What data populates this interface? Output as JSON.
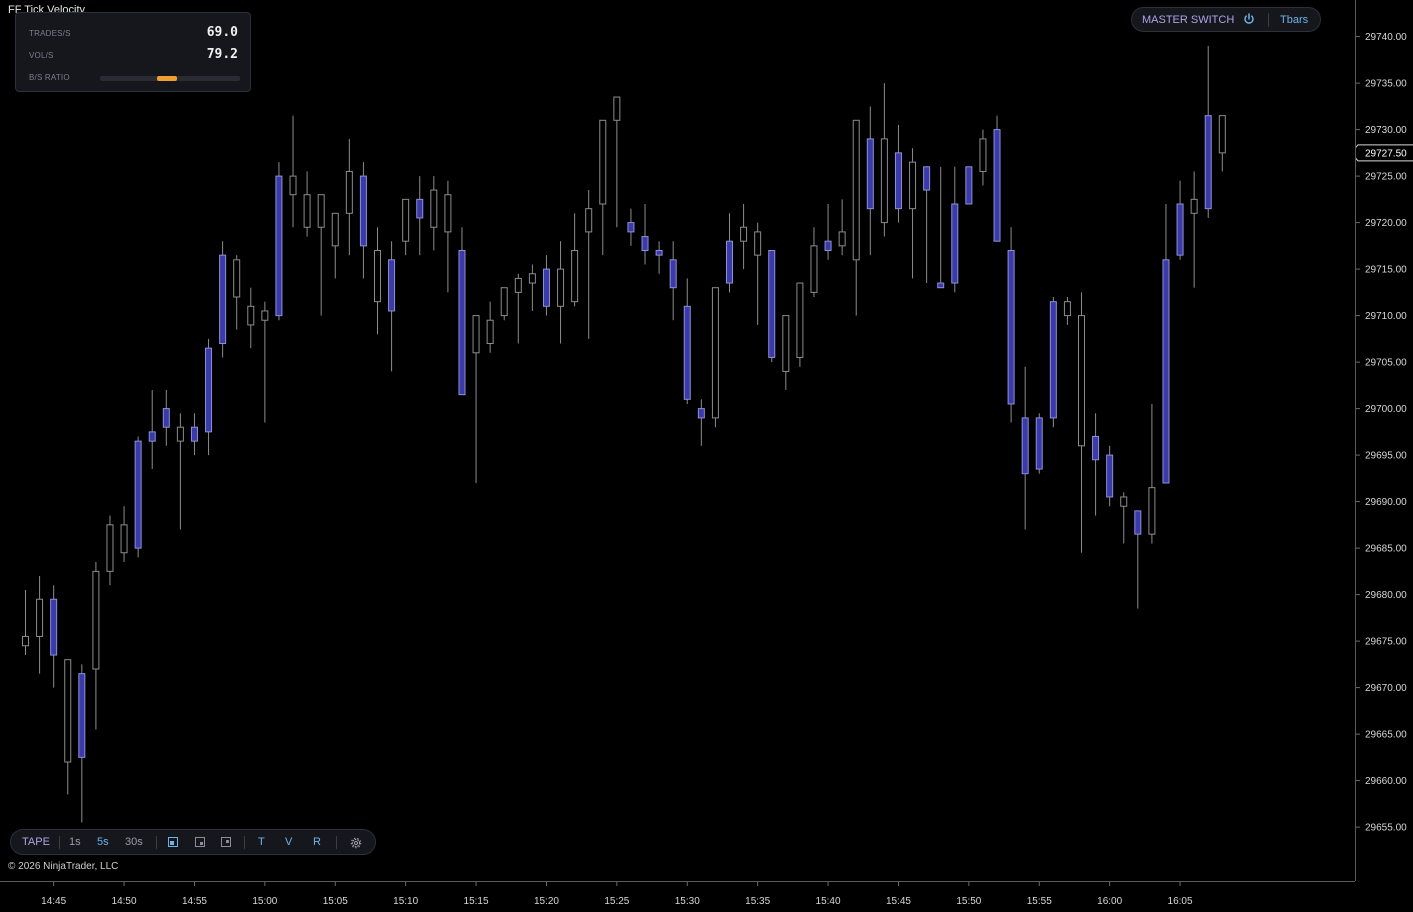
{
  "indicator": {
    "title": "FF Tick Velocity",
    "trades_label": "TRADES/S",
    "trades_value": "69.0",
    "vol_label": "VOL/S",
    "vol_value": "79.2",
    "ratio_label": "B/S RATIO",
    "ratio_value": 0.48,
    "ratio_color": "#f0a030"
  },
  "master_switch": {
    "label": "MASTER SWITCH",
    "power_icon": "power-icon",
    "tbars_label": "Tbars"
  },
  "toolbar": {
    "tape_label": "TAPE",
    "intervals": [
      "1s",
      "5s",
      "30s"
    ],
    "layout_icons": [
      "layout-single-icon",
      "layout-split-icon",
      "layout-grid-icon"
    ],
    "toggles": [
      "T",
      "V",
      "R"
    ],
    "settings_icon": "gear-icon"
  },
  "copyright": "© 2026 NinjaTrader, LLC",
  "colors": {
    "background": "#000000",
    "up_fill": "#000000",
    "up_border": "#8c8c8c",
    "down_fill": "#3a3aa8",
    "down_border": "#8f8fd8",
    "wick": "#8c8c8c",
    "axis_text": "#d8d8d8"
  },
  "chart_data": {
    "type": "candlestick",
    "y_axis_ticks": [
      "29740.00",
      "29735.00",
      "29730.00",
      "29725.00",
      "29720.00",
      "29715.00",
      "29710.00",
      "29705.00",
      "29700.00",
      "29695.00",
      "29690.00",
      "29685.00",
      "29680.00",
      "29675.00",
      "29670.00",
      "29665.00",
      "29660.00",
      "29655.00"
    ],
    "ylim": [
      29652,
      29742
    ],
    "x_axis_labels": [
      "14:45",
      "14:50",
      "14:55",
      "15:00",
      "15:05",
      "15:10",
      "15:15",
      "15:20",
      "15:25",
      "15:30",
      "15:35",
      "15:40",
      "15:45",
      "15:50",
      "15:55",
      "16:00",
      "16:05"
    ],
    "current_price": "29727.50",
    "candles": [
      {
        "o": 29674.5,
        "h": 29680.5,
        "l": 29673.5,
        "c": 29675.5
      },
      {
        "o": 29675.5,
        "h": 29682.0,
        "l": 29671.5,
        "c": 29679.5
      },
      {
        "o": 29679.5,
        "h": 29681.0,
        "l": 29670.0,
        "c": 29673.5
      },
      {
        "o": 29662.0,
        "h": 29673.0,
        "l": 29658.5,
        "c": 29673.0
      },
      {
        "o": 29671.5,
        "h": 29672.5,
        "l": 29655.5,
        "c": 29662.5
      },
      {
        "o": 29672.0,
        "h": 29683.5,
        "l": 29665.5,
        "c": 29682.5
      },
      {
        "o": 29682.5,
        "h": 29688.5,
        "l": 29681.0,
        "c": 29687.5
      },
      {
        "o": 29684.5,
        "h": 29689.5,
        "l": 29683.5,
        "c": 29687.5
      },
      {
        "o": 29696.5,
        "h": 29697.0,
        "l": 29684.0,
        "c": 29685.0
      },
      {
        "o": 29697.5,
        "h": 29702.0,
        "l": 29693.5,
        "c": 29696.5
      },
      {
        "o": 29700.0,
        "h": 29702.0,
        "l": 29696.0,
        "c": 29698.0
      },
      {
        "o": 29696.5,
        "h": 29699.5,
        "l": 29687.0,
        "c": 29698.0
      },
      {
        "o": 29698.0,
        "h": 29699.5,
        "l": 29695.0,
        "c": 29696.5
      },
      {
        "o": 29706.5,
        "h": 29707.5,
        "l": 29695.0,
        "c": 29697.5
      },
      {
        "o": 29716.5,
        "h": 29718.0,
        "l": 29705.5,
        "c": 29707.0
      },
      {
        "o": 29712.0,
        "h": 29716.5,
        "l": 29708.5,
        "c": 29716.0
      },
      {
        "o": 29709.0,
        "h": 29713.0,
        "l": 29706.5,
        "c": 29711.0
      },
      {
        "o": 29709.5,
        "h": 29711.5,
        "l": 29698.5,
        "c": 29710.5
      },
      {
        "o": 29725.0,
        "h": 29726.5,
        "l": 29709.5,
        "c": 29710.0
      },
      {
        "o": 29723.0,
        "h": 29731.5,
        "l": 29719.5,
        "c": 29725.0
      },
      {
        "o": 29719.5,
        "h": 29725.5,
        "l": 29718.5,
        "c": 29723.0
      },
      {
        "o": 29719.5,
        "h": 29722.0,
        "l": 29710.0,
        "c": 29723.0
      },
      {
        "o": 29717.5,
        "h": 29721.0,
        "l": 29714.0,
        "c": 29721.0
      },
      {
        "o": 29721.0,
        "h": 29729.0,
        "l": 29716.5,
        "c": 29725.5
      },
      {
        "o": 29725.0,
        "h": 29726.5,
        "l": 29714.0,
        "c": 29717.5
      },
      {
        "o": 29711.5,
        "h": 29719.5,
        "l": 29708.0,
        "c": 29717.0
      },
      {
        "o": 29716.0,
        "h": 29718.0,
        "l": 29704.0,
        "c": 29710.5
      },
      {
        "o": 29718.0,
        "h": 29720.0,
        "l": 29716.5,
        "c": 29722.5
      },
      {
        "o": 29722.5,
        "h": 29725.0,
        "l": 29716.5,
        "c": 29720.5
      },
      {
        "o": 29719.5,
        "h": 29725.0,
        "l": 29717.0,
        "c": 29723.5
      },
      {
        "o": 29719.0,
        "h": 29724.5,
        "l": 29712.5,
        "c": 29723.0
      },
      {
        "o": 29717.0,
        "h": 29719.5,
        "l": 29702.0,
        "c": 29701.5
      },
      {
        "o": 29706.0,
        "h": 29707.0,
        "l": 29692.0,
        "c": 29710.0
      },
      {
        "o": 29707.0,
        "h": 29711.5,
        "l": 29706.0,
        "c": 29709.5
      },
      {
        "o": 29710.0,
        "h": 29713.0,
        "l": 29709.5,
        "c": 29713.0
      },
      {
        "o": 29712.5,
        "h": 29714.5,
        "l": 29707.0,
        "c": 29714.0
      },
      {
        "o": 29713.5,
        "h": 29715.5,
        "l": 29710.5,
        "c": 29714.5
      },
      {
        "o": 29715.0,
        "h": 29716.5,
        "l": 29710.0,
        "c": 29711.0
      },
      {
        "o": 29711.0,
        "h": 29718.0,
        "l": 29707.0,
        "c": 29715.0
      },
      {
        "o": 29711.5,
        "h": 29721.0,
        "l": 29711.0,
        "c": 29717.0
      },
      {
        "o": 29719.0,
        "h": 29723.5,
        "l": 29707.5,
        "c": 29721.5
      },
      {
        "o": 29722.0,
        "h": 29727.0,
        "l": 29716.5,
        "c": 29731.0
      },
      {
        "o": 29731.0,
        "h": 29731.5,
        "l": 29719.5,
        "c": 29733.5
      },
      {
        "o": 29720.0,
        "h": 29721.5,
        "l": 29717.5,
        "c": 29719.0
      },
      {
        "o": 29718.5,
        "h": 29722.0,
        "l": 29715.5,
        "c": 29717.0
      },
      {
        "o": 29717.0,
        "h": 29718.0,
        "l": 29714.5,
        "c": 29716.5
      },
      {
        "o": 29716.0,
        "h": 29718.0,
        "l": 29709.5,
        "c": 29713.0
      },
      {
        "o": 29711.0,
        "h": 29714.0,
        "l": 29700.5,
        "c": 29701.0
      },
      {
        "o": 29700.0,
        "h": 29701.0,
        "l": 29696.0,
        "c": 29699.0
      },
      {
        "o": 29699.0,
        "h": 29713.0,
        "l": 29698.0,
        "c": 29713.0
      },
      {
        "o": 29718.0,
        "h": 29721.0,
        "l": 29712.5,
        "c": 29713.5
      },
      {
        "o": 29718.0,
        "h": 29722.0,
        "l": 29715.0,
        "c": 29719.5
      },
      {
        "o": 29716.5,
        "h": 29720.0,
        "l": 29709.0,
        "c": 29719.0
      },
      {
        "o": 29717.0,
        "h": 29716.0,
        "l": 29705.0,
        "c": 29705.5
      },
      {
        "o": 29704.0,
        "h": 29710.0,
        "l": 29702.0,
        "c": 29710.0
      },
      {
        "o": 29705.5,
        "h": 29705.5,
        "l": 29704.5,
        "c": 29713.5
      },
      {
        "o": 29712.5,
        "h": 29719.5,
        "l": 29712.0,
        "c": 29717.5
      },
      {
        "o": 29718.0,
        "h": 29722.0,
        "l": 29716.0,
        "c": 29717.0
      },
      {
        "o": 29717.5,
        "h": 29722.5,
        "l": 29716.5,
        "c": 29719.0
      },
      {
        "o": 29716.0,
        "h": 29722.0,
        "l": 29710.0,
        "c": 29731.0
      },
      {
        "o": 29729.0,
        "h": 29732.5,
        "l": 29716.5,
        "c": 29721.5
      },
      {
        "o": 29720.0,
        "h": 29735.0,
        "l": 29718.5,
        "c": 29729.0
      },
      {
        "o": 29727.5,
        "h": 29730.5,
        "l": 29720.0,
        "c": 29721.5
      },
      {
        "o": 29721.5,
        "h": 29728.0,
        "l": 29714.0,
        "c": 29726.5
      },
      {
        "o": 29726.0,
        "h": 29725.5,
        "l": 29713.5,
        "c": 29723.5
      },
      {
        "o": 29713.5,
        "h": 29726.0,
        "l": 29713.0,
        "c": 29713.0
      },
      {
        "o": 29722.0,
        "h": 29726.0,
        "l": 29712.5,
        "c": 29713.5
      },
      {
        "o": 29726.0,
        "h": 29725.5,
        "l": 29722.5,
        "c": 29722.0
      },
      {
        "o": 29725.5,
        "h": 29730.0,
        "l": 29724.0,
        "c": 29729.0
      },
      {
        "o": 29730.0,
        "h": 29731.5,
        "l": 29718.0,
        "c": 29718.0
      },
      {
        "o": 29717.0,
        "h": 29719.5,
        "l": 29698.5,
        "c": 29700.5
      },
      {
        "o": 29699.0,
        "h": 29704.5,
        "l": 29687.0,
        "c": 29693.0
      },
      {
        "o": 29699.0,
        "h": 29699.5,
        "l": 29693.0,
        "c": 29693.5
      },
      {
        "o": 29711.5,
        "h": 29712.0,
        "l": 29698.0,
        "c": 29699.0
      },
      {
        "o": 29710.0,
        "h": 29712.0,
        "l": 29709.0,
        "c": 29711.5
      },
      {
        "o": 29696.0,
        "h": 29712.5,
        "l": 29684.5,
        "c": 29710.0
      },
      {
        "o": 29697.0,
        "h": 29699.5,
        "l": 29688.5,
        "c": 29694.5
      },
      {
        "o": 29695.0,
        "h": 29696.0,
        "l": 29689.5,
        "c": 29690.5
      },
      {
        "o": 29689.5,
        "h": 29691.0,
        "l": 29685.5,
        "c": 29690.5
      },
      {
        "o": 29689.0,
        "h": 29688.5,
        "l": 29678.5,
        "c": 29686.5
      },
      {
        "o": 29686.5,
        "h": 29700.5,
        "l": 29685.5,
        "c": 29691.5
      },
      {
        "o": 29716.0,
        "h": 29722.0,
        "l": 29692.0,
        "c": 29692.0
      },
      {
        "o": 29722.0,
        "h": 29724.5,
        "l": 29716.0,
        "c": 29716.5
      },
      {
        "o": 29721.0,
        "h": 29725.5,
        "l": 29713.0,
        "c": 29722.5
      },
      {
        "o": 29731.5,
        "h": 29739.0,
        "l": 29720.5,
        "c": 29721.5
      },
      {
        "o": 29727.5,
        "h": 29731.5,
        "l": 29725.5,
        "c": 29731.5
      }
    ]
  }
}
